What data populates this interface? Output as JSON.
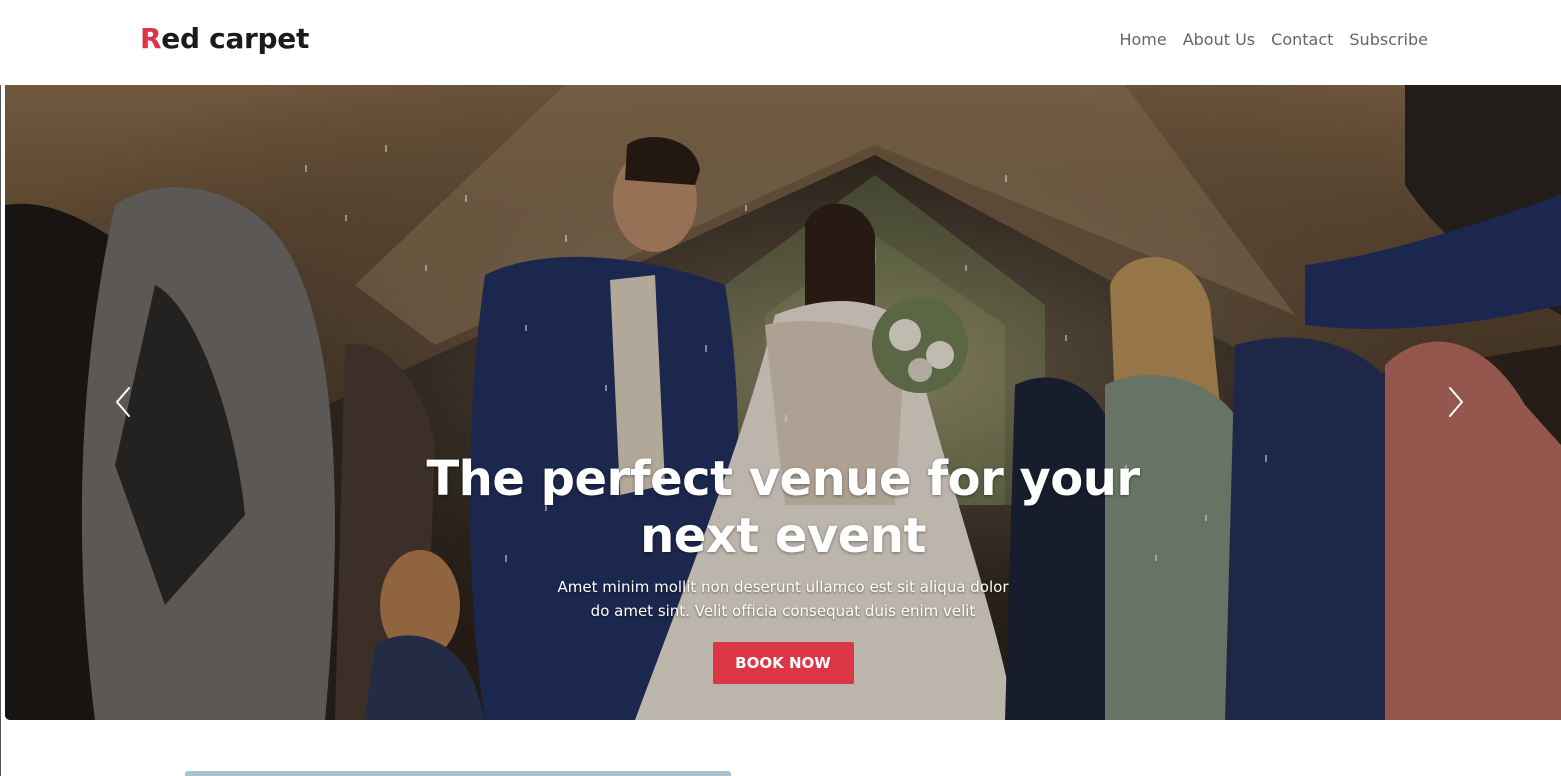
{
  "header": {
    "logo_first_letter": "R",
    "logo_rest": "ed carpet",
    "nav": [
      {
        "label": "Home"
      },
      {
        "label": "About Us"
      },
      {
        "label": "Contact"
      },
      {
        "label": "Subscribe"
      }
    ]
  },
  "hero": {
    "headline": "The perfect venue for your next event",
    "subtext": "Amet minim mollit non deserunt ullamco est sit aliqua dolor do amet sint. Velit officia consequat duis enim velit",
    "button_label": "BOOK NOW",
    "prev_icon": "chevron-left-icon",
    "next_icon": "chevron-right-icon"
  },
  "colors": {
    "accent": "#dc3545",
    "logo_text": "#1b1b1b",
    "nav_text": "#666666"
  }
}
